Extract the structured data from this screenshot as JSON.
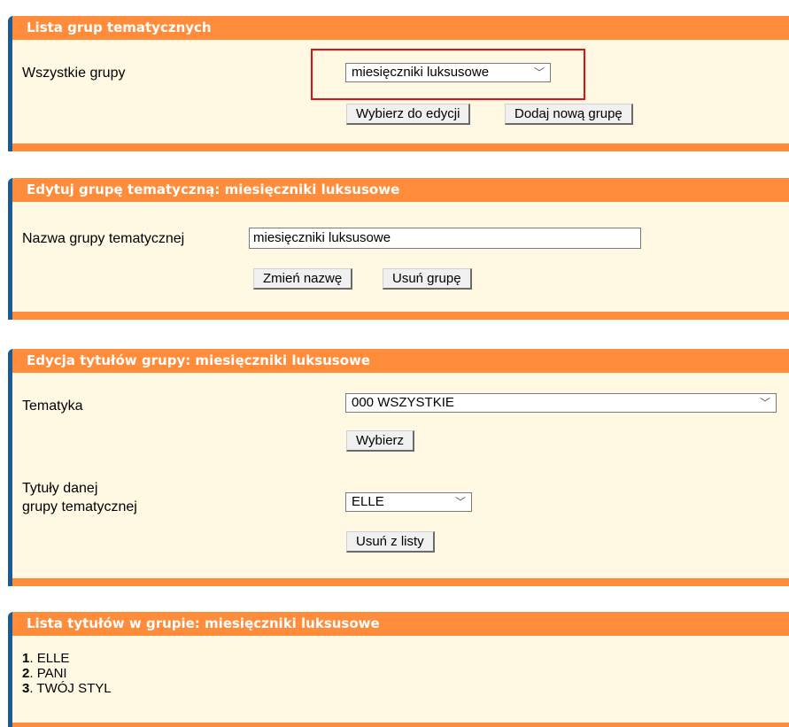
{
  "panel_groups": {
    "header": "Lista grup tematycznych",
    "all_groups_label": "Wszystkie grupy",
    "selected_group": "miesięczniki luksusowe",
    "select_for_edit": "Wybierz do edycji",
    "add_group": "Dodaj nową grupę"
  },
  "panel_edit_group": {
    "header": "Edytuj grupę tematyczną: miesięczniki luksusowe",
    "name_label": "Nazwa grupy tematycznej",
    "name_value": "miesięczniki luksusowe",
    "rename": "Zmień nazwę",
    "delete_group": "Usuń grupę"
  },
  "panel_titles_edit": {
    "header": "Edycja tytułów grupy: miesięczniki luksusowe",
    "topic_label": "Tematyka",
    "topic_value": "000 WSZYSTKIE",
    "choose": "Wybierz",
    "titles_label_line1": "Tytuły danej",
    "titles_label_line2": "grupy tematycznej",
    "title_value": "ELLE",
    "remove_from_list": "Usuń z listy"
  },
  "panel_titles_list": {
    "header": "Lista tytułów w grupie: miesięczniki luksusowe",
    "items": [
      {
        "num": "1",
        "name": "ELLE"
      },
      {
        "num": "2",
        "name": "PANI"
      },
      {
        "num": "3",
        "name": "TWÓJ STYL"
      }
    ]
  },
  "icons": {
    "dropdown": "chevron-down-icon"
  },
  "colors": {
    "header": "#ff8c3a",
    "panel_bg": "#fff8e2",
    "accent_left": "#1c5a96",
    "highlight": "#e01010"
  }
}
